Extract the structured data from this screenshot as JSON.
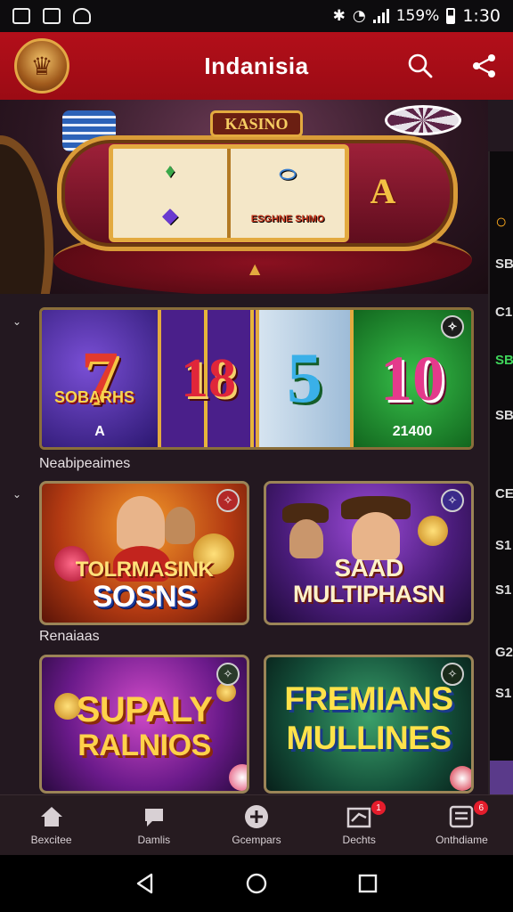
{
  "status_bar": {
    "battery": "159%",
    "time": "1:30"
  },
  "header": {
    "title": "Indanisia",
    "search_icon": "search-icon",
    "share_icon": "share-icon"
  },
  "hero": {
    "sign": "KASINO",
    "left_symbol": "A",
    "right_symbol": "A",
    "reel_text": "ESGHNE SHMO"
  },
  "strip": {
    "tiles": [
      {
        "big": "7",
        "text": "SOBARHS",
        "sub": "A"
      },
      {
        "big": "18"
      },
      {
        "big": "5"
      },
      {
        "big": "10",
        "sub": "21400"
      }
    ]
  },
  "sections": [
    {
      "label": "Neabipeaimes"
    },
    {
      "label": "Renaiaas"
    }
  ],
  "cards": [
    {
      "title_line1": "TOLRMASINK",
      "title_line2": "SOSNS"
    },
    {
      "title_line1": "SAAD",
      "title_line2": "MULTIPHASN"
    },
    {
      "title_line1": "SUPALY",
      "title_line2": "RALNIOS"
    },
    {
      "title_line1": "FREMIANS",
      "title_line2": "MULLINES"
    }
  ],
  "right_panel": [
    "SB",
    "SB",
    "C1",
    "SB",
    "CE",
    "S1",
    "S1",
    "G2",
    "S1"
  ],
  "bottom_nav": [
    {
      "label": "Bexcitee",
      "icon": "home-icon"
    },
    {
      "label": "Damlis",
      "icon": "chat-icon"
    },
    {
      "label": "Gcempars",
      "icon": "gamepad-icon"
    },
    {
      "label": "Dechts",
      "icon": "gift-icon",
      "badge": "1"
    },
    {
      "label": "Onthdiame",
      "icon": "list-icon",
      "badge": "6"
    }
  ],
  "colors": {
    "header": "#b30f1a",
    "background": "#231820",
    "gold": "#e3aa3f"
  }
}
